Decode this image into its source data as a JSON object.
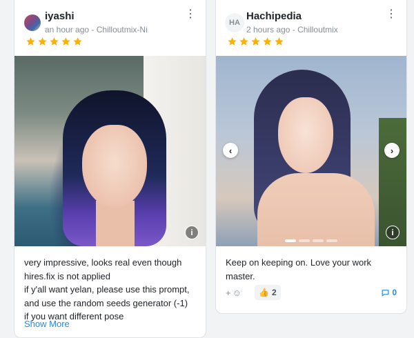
{
  "colors": {
    "star": "#fab005",
    "link": "#228be6",
    "page_bg": "#f1f3f5"
  },
  "reviews": [
    {
      "user": "iyashi",
      "time": "an hour ago",
      "separator": " - ",
      "model": "Chilloutmix-Ni",
      "rating": 5,
      "comment_lines": [
        "very impressive, looks real even though hires.fix is not applied",
        "if y'all want yelan, please use this prompt, and use the random seeds generator (-1)",
        "if you want different pose"
      ],
      "show_more": "Show More"
    },
    {
      "user": "Hachipedia",
      "avatar_initials": "HA",
      "time": "2 hours ago",
      "separator": " - ",
      "model": "Chilloutmix",
      "rating": 5,
      "comment_lines": [
        "Keep on keeping on. Love your work master."
      ],
      "reaction_emoji": "👍",
      "reaction_count": "2",
      "comment_count": "0",
      "prev_glyph": "‹",
      "next_glyph": "›",
      "slides": 4,
      "active_slide": 0
    }
  ],
  "icons": {
    "menu": "kebab-menu-icon",
    "info": "info-icon",
    "star": "star-icon",
    "add_reaction": "add-reaction-icon",
    "comment": "comment-icon"
  },
  "glyphs": {
    "kebab": "⋮",
    "info": "i",
    "plus": "+",
    "smile": "☺"
  }
}
